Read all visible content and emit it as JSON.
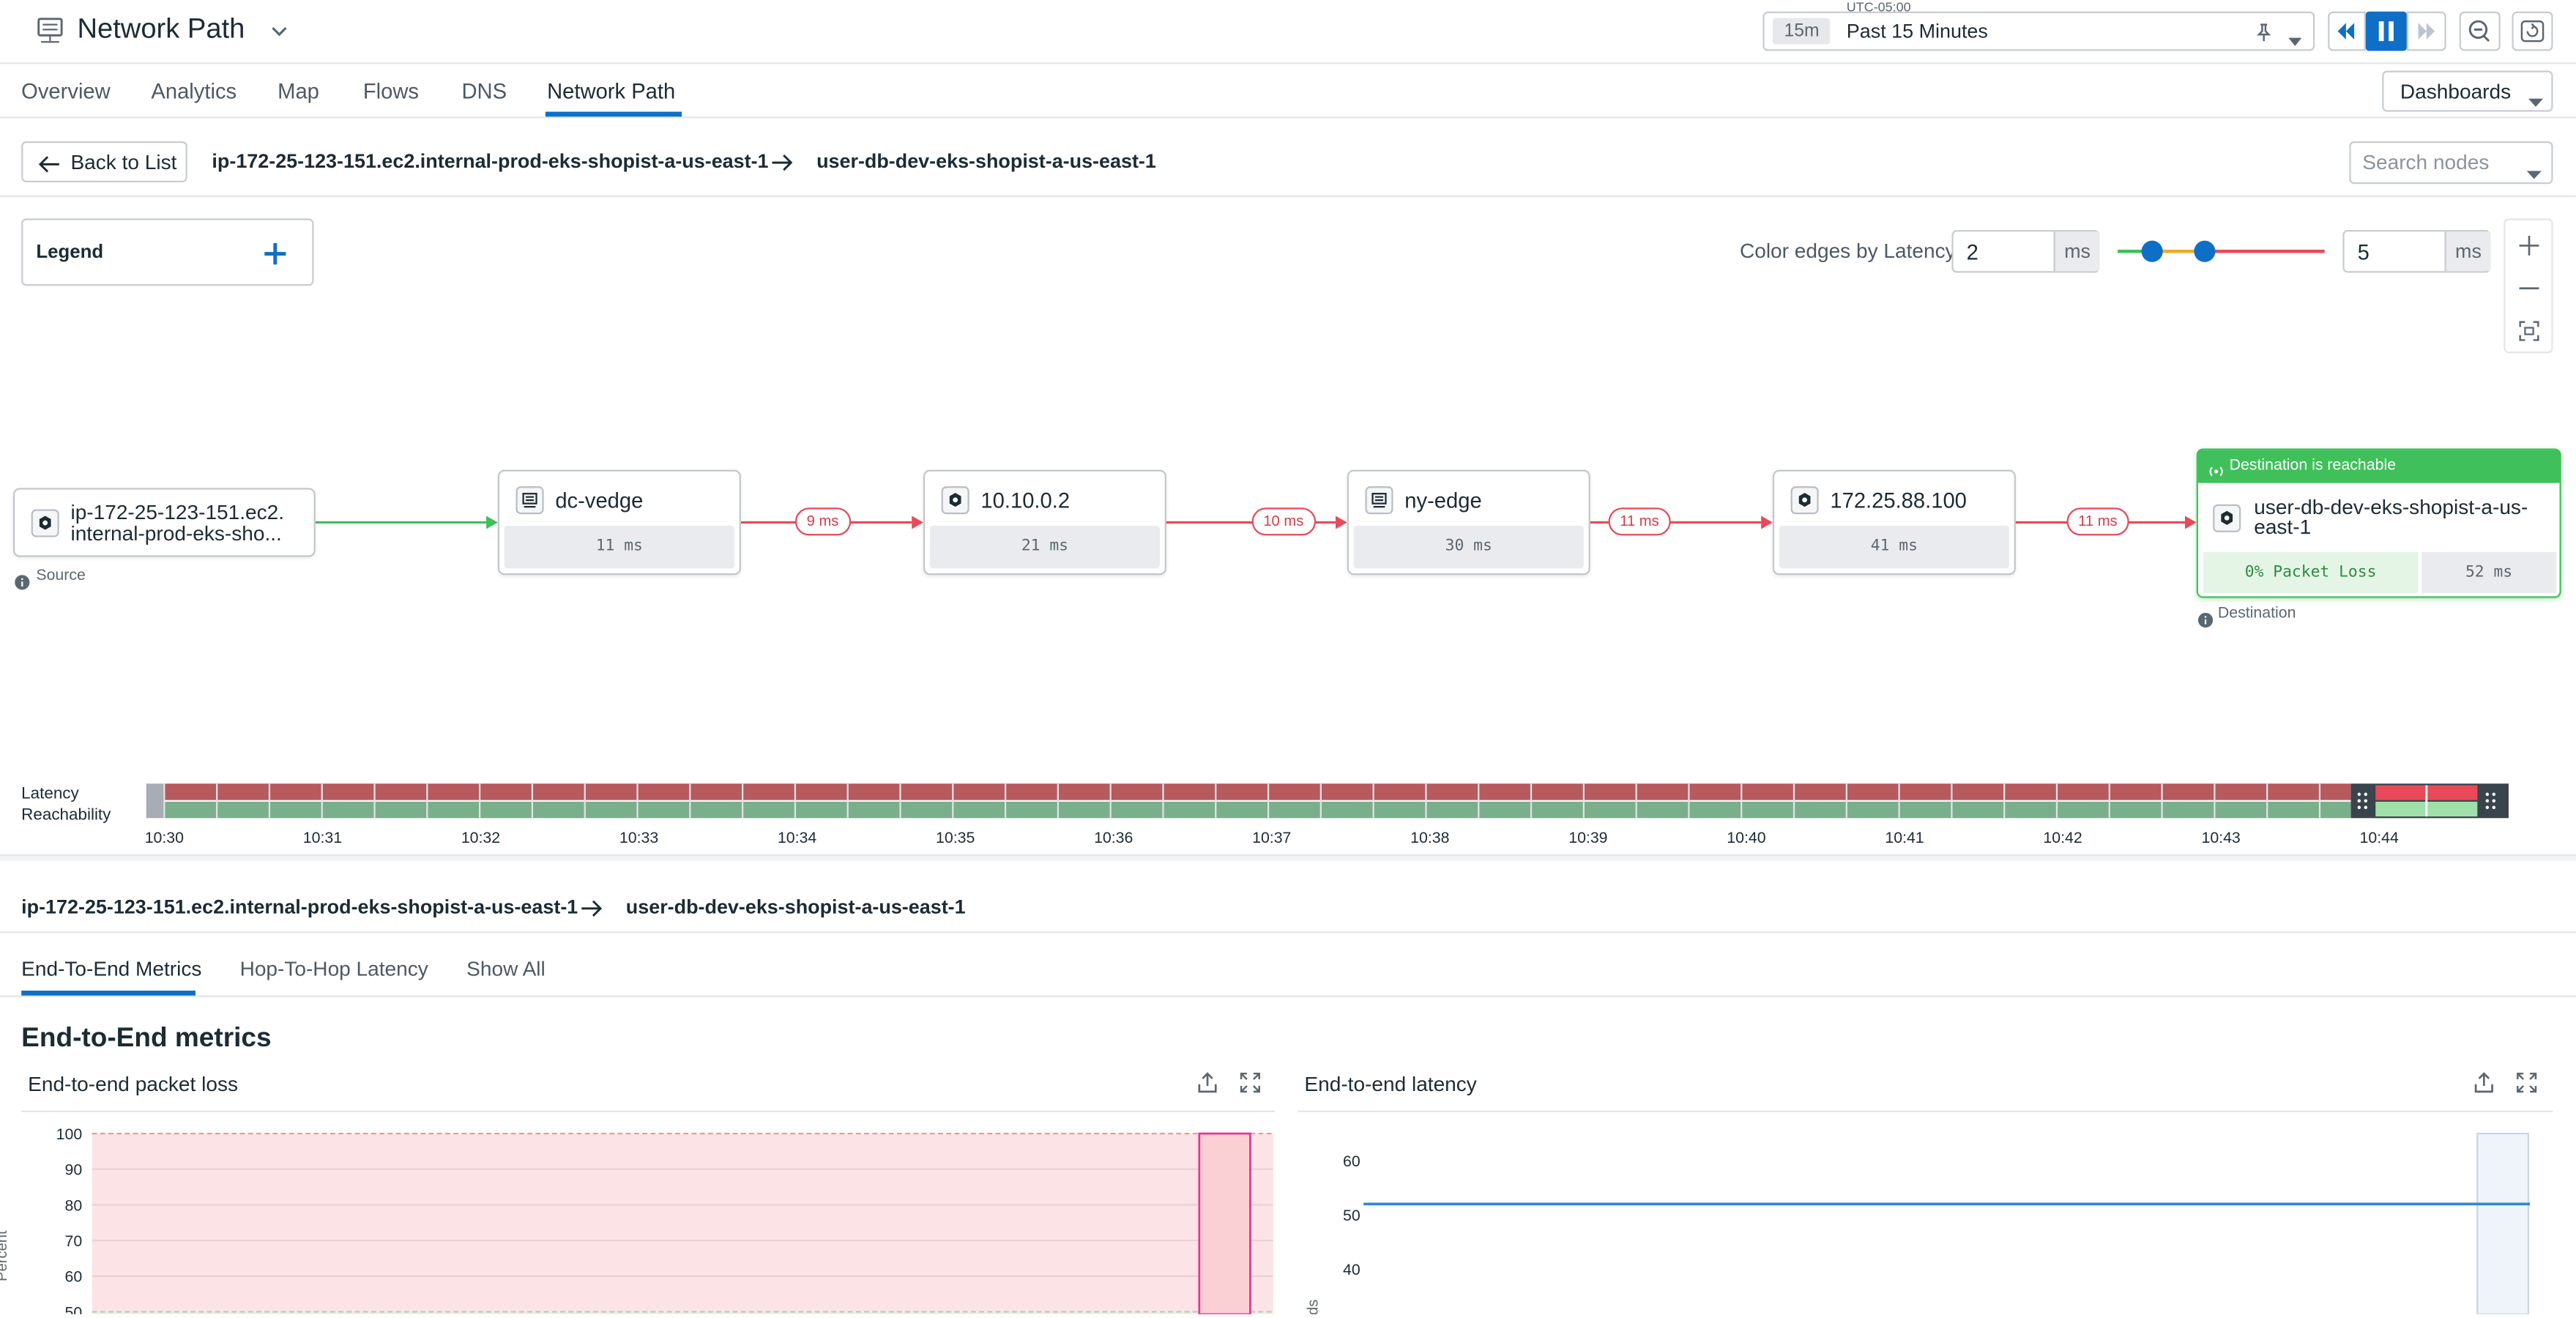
{
  "header": {
    "title": "Network Path",
    "timezone": "UTC-05:00",
    "time_badge": "15m",
    "time_range": "Past 15 Minutes"
  },
  "nav": {
    "tabs": [
      "Overview",
      "Analytics",
      "Map",
      "Flows",
      "DNS",
      "Network Path"
    ],
    "active": "Network Path",
    "dashboards": "Dashboards"
  },
  "path_bar": {
    "back": "Back to List",
    "source": "ip-172-25-123-151.ec2.internal-prod-eks-shopist-a-us-east-1",
    "destination": "user-db-dev-eks-shopist-a-us-east-1",
    "search_placeholder": "Search nodes"
  },
  "legend": {
    "label": "Legend"
  },
  "latency_color": {
    "label": "Color edges by Latency",
    "min": "2",
    "max": "5",
    "unit": "ms"
  },
  "nodes": {
    "source": {
      "name_l1": "ip-172-25-123-151.ec2.",
      "name_l2": "internal-prod-eks-sho...",
      "caption": "Source"
    },
    "hops": [
      {
        "name": "dc-vedge",
        "latency": "11 ms"
      },
      {
        "name": "10.10.0.2",
        "latency": "21 ms"
      },
      {
        "name": "ny-edge",
        "latency": "30 ms"
      },
      {
        "name": "172.25.88.100",
        "latency": "41 ms"
      }
    ],
    "edges": [
      "9 ms",
      "10 ms",
      "11 ms",
      "11 ms"
    ],
    "destination": {
      "banner": "Destination is reachable",
      "name_l1": "user-db-dev-eks-shopist-a-us-",
      "name_l2": "east-1",
      "packet_loss": "0% Packet Loss",
      "latency": "52 ms",
      "caption": "Destination"
    }
  },
  "timeline": {
    "labels": [
      "Latency",
      "Reachability"
    ],
    "ticks": [
      "10:30",
      "10:31",
      "10:32",
      "10:33",
      "10:34",
      "10:35",
      "10:36",
      "10:37",
      "10:38",
      "10:39",
      "10:40",
      "10:41",
      "10:42",
      "10:43",
      "10:44"
    ]
  },
  "details": {
    "source": "ip-172-25-123-151.ec2.internal-prod-eks-shopist-a-us-east-1",
    "destination": "user-db-dev-eks-shopist-a-us-east-1",
    "tabs": [
      "End-To-End Metrics",
      "Hop-To-Hop Latency",
      "Show All"
    ],
    "active": "End-To-End Metrics",
    "section_title": "End-to-End metrics"
  },
  "chart_data": [
    {
      "type": "area",
      "title": "End-to-end packet loss",
      "ylabel": "Percent",
      "y_ticks": [
        100,
        90,
        80,
        70,
        60,
        50
      ],
      "series": [
        {
          "values": [
            100
          ]
        }
      ]
    },
    {
      "type": "line",
      "title": "End-to-end latency",
      "ylabel": "Milliseconds",
      "y_ticks": [
        60,
        50,
        40
      ],
      "series": [
        {
          "values": [
            52
          ]
        }
      ]
    }
  ],
  "colors": {
    "accent": "#0f6fc6",
    "good": "#3fc05a",
    "bad": "#e84a59",
    "warn": "#f0a830"
  }
}
